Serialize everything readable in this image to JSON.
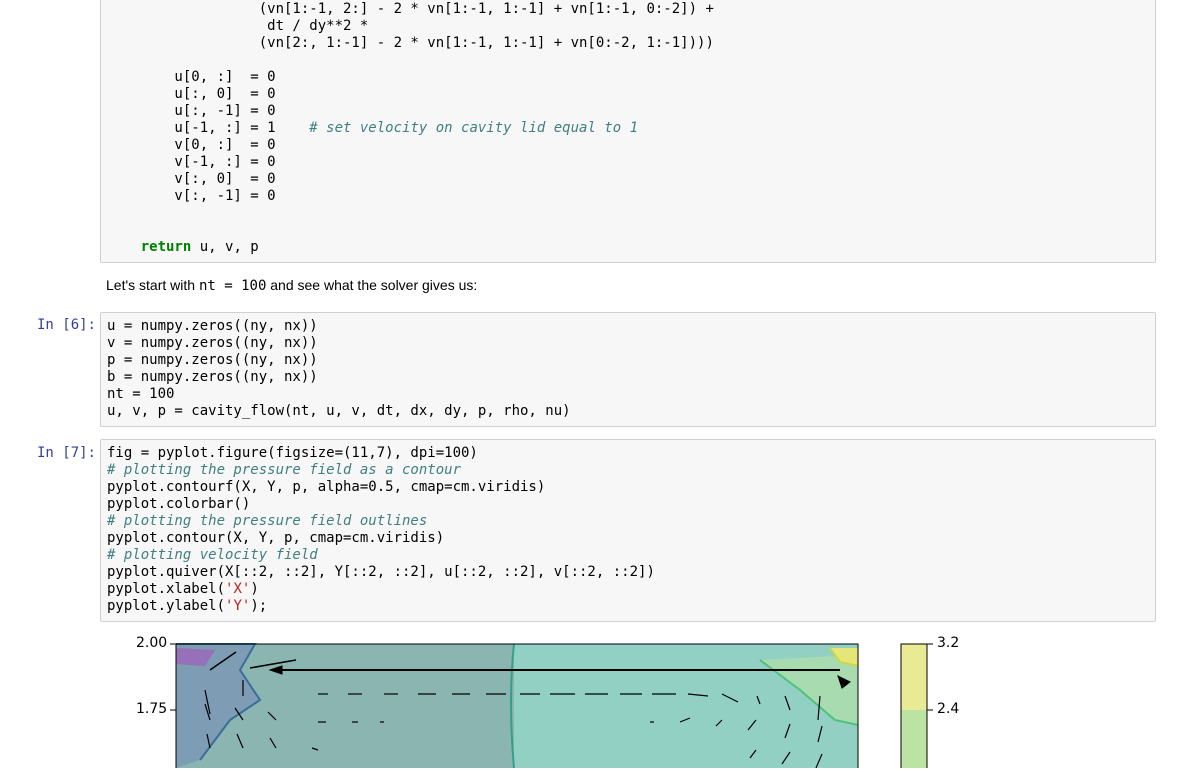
{
  "top_cell_lines": [
    "                  (vn[1:-1, 2:] - 2 * vn[1:-1, 1:-1] + vn[1:-1, 0:-2]) +",
    "                   dt / dy**2 *",
    "                  (vn[2:, 1:-1] - 2 * vn[1:-1, 1:-1] + vn[0:-2, 1:-1])))",
    "",
    "        u[0, :]  = 0",
    "        u[:, 0]  = 0",
    "        u[:, -1] = 0",
    "        u[-1, :] = 1    # set velocity on cavity lid equal to 1",
    "        v[0, :]  = 0",
    "        v[-1, :] = 0",
    "        v[:, 0]  = 0",
    "        v[:, -1] = 0",
    "",
    "",
    "    return u, v, p"
  ],
  "markdown": {
    "before": "Let's start with ",
    "code": "nt = 100",
    "after": " and see what the solver gives us:"
  },
  "cell6": {
    "prompt": "In [6]:",
    "lines": [
      "u = numpy.zeros((ny, nx))",
      "v = numpy.zeros((ny, nx))",
      "p = numpy.zeros((ny, nx))",
      "b = numpy.zeros((ny, nx))",
      "nt = 100",
      "u, v, p = cavity_flow(nt, u, v, dt, dx, dy, p, rho, nu)"
    ]
  },
  "cell7": {
    "prompt": "In [7]:",
    "lines": [
      "fig = pyplot.figure(figsize=(11,7), dpi=100)",
      "# plotting the pressure field as a contour",
      "pyplot.contourf(X, Y, p, alpha=0.5, cmap=cm.viridis)",
      "pyplot.colorbar()",
      "# plotting the pressure field outlines",
      "pyplot.contour(X, Y, p, cmap=cm.viridis)",
      "# plotting velocity field",
      "pyplot.quiver(X[::2, ::2], Y[::2, ::2], u[::2, ::2], v[::2, ::2])",
      "pyplot.xlabel('X')",
      "pyplot.ylabel('Y');"
    ]
  },
  "plot": {
    "y_ticks": [
      "2.00",
      "1.75"
    ],
    "colorbar_ticks": [
      "3.2",
      "2.4"
    ]
  }
}
